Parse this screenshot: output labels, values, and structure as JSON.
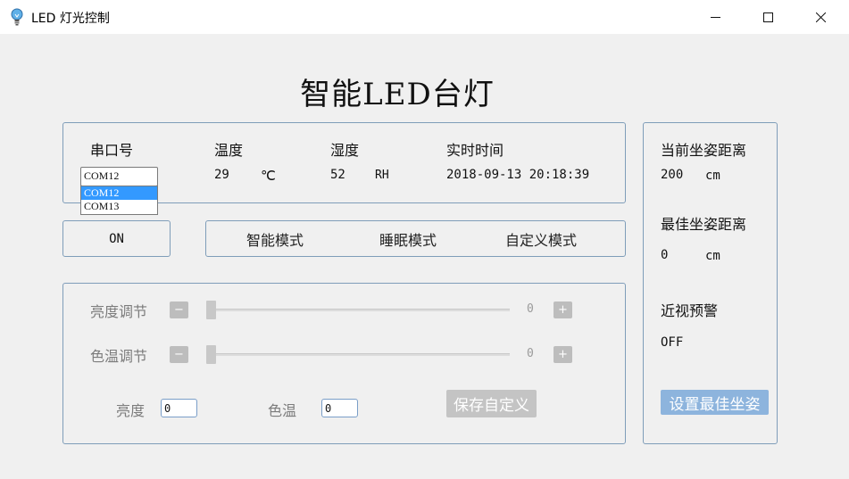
{
  "window": {
    "title": "LED 灯光控制",
    "icon": "lightbulb-icon",
    "controls": {
      "minimize": "—",
      "maximize": "☐",
      "close": "✕"
    }
  },
  "heading": "智能LED台灯",
  "status": {
    "serial_label": "串口号",
    "serial_value": "COM12",
    "serial_options": [
      "COM12",
      "COM13"
    ],
    "temp_label": "温度",
    "temp_value": "29",
    "temp_unit": "℃",
    "humidity_label": "湿度",
    "humidity_value": "52",
    "humidity_unit": "RH",
    "time_label": "实时时间",
    "time_value": "2018-09-13 20:18:39"
  },
  "power_button": "ON",
  "modes": [
    "智能模式",
    "睡眠模式",
    "自定义模式"
  ],
  "controls": {
    "brightness_label": "亮度调节",
    "brightness_value": "0",
    "brightness_level": 0,
    "colortemp_label": "色温调节",
    "colortemp_value": "0",
    "colortemp_level": 0,
    "minus": "−",
    "plus": "+",
    "brightness_input_label": "亮度",
    "brightness_input_value": "0",
    "colortemp_input_label": "色温",
    "colortemp_input_value": "0",
    "save_button": "保存自定义"
  },
  "posture": {
    "current_label": "当前坐姿距离",
    "current_value": "200",
    "current_unit": "cm",
    "best_label": "最佳坐姿距离",
    "best_value": "0",
    "best_unit": "cm",
    "warning_label": "近视预警",
    "warning_value": "OFF",
    "set_button": "设置最佳坐姿"
  },
  "colors": {
    "panel_border": "#7f9db9",
    "selection": "#3399ff",
    "set_button_bg": "#8db4dd",
    "disabled_button_bg": "#c4c4c4"
  }
}
